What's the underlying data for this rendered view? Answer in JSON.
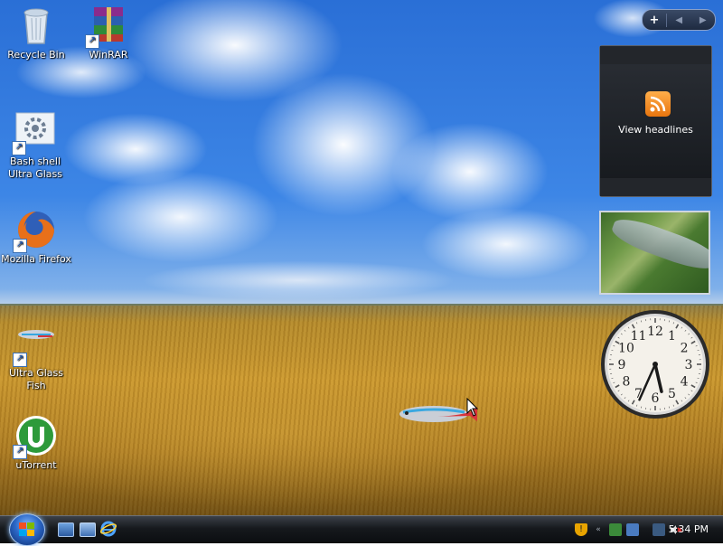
{
  "desktop_icons": [
    {
      "label": "Recycle Bin",
      "icon": "recycle-bin-icon"
    },
    {
      "label": "WinRAR",
      "icon": "winrar-icon"
    },
    {
      "label": "Bash shell Ultra Glass",
      "icon": "bash-shell-icon"
    },
    {
      "label": "Mozilla Firefox",
      "icon": "firefox-icon"
    },
    {
      "label": "Ultra Glass Fish",
      "icon": "fish-icon"
    },
    {
      "label": "uTorrent",
      "icon": "utorrent-icon"
    }
  ],
  "sidebar": {
    "add_button": "+",
    "prev_arrow": "◀",
    "next_arrow": "▶",
    "feed_gadget": {
      "label": "View headlines",
      "icon": "rss-icon"
    },
    "slideshow_gadget": {
      "icon": "slideshow-image"
    },
    "clock": {
      "numbers": [
        "12",
        "1",
        "2",
        "3",
        "4",
        "5",
        "6",
        "7",
        "8",
        "9",
        "10",
        "11"
      ],
      "hour": 5,
      "minute": 34
    }
  },
  "taskbar": {
    "start_icon": "windows-flag-icon",
    "quick_launch": [
      "show-desktop-icon",
      "switch-windows-icon",
      "internet-explorer-icon"
    ],
    "tray_icons": [
      "security-shield-icon",
      "network-icon",
      "display-icon",
      "network-connection-icon",
      "volume-muted-icon"
    ],
    "time": "5:34 PM"
  },
  "colors": {
    "sky": "#2a6fd6",
    "field": "#c9962e",
    "taskbar": "#16191d",
    "rss": "#e8750e"
  }
}
